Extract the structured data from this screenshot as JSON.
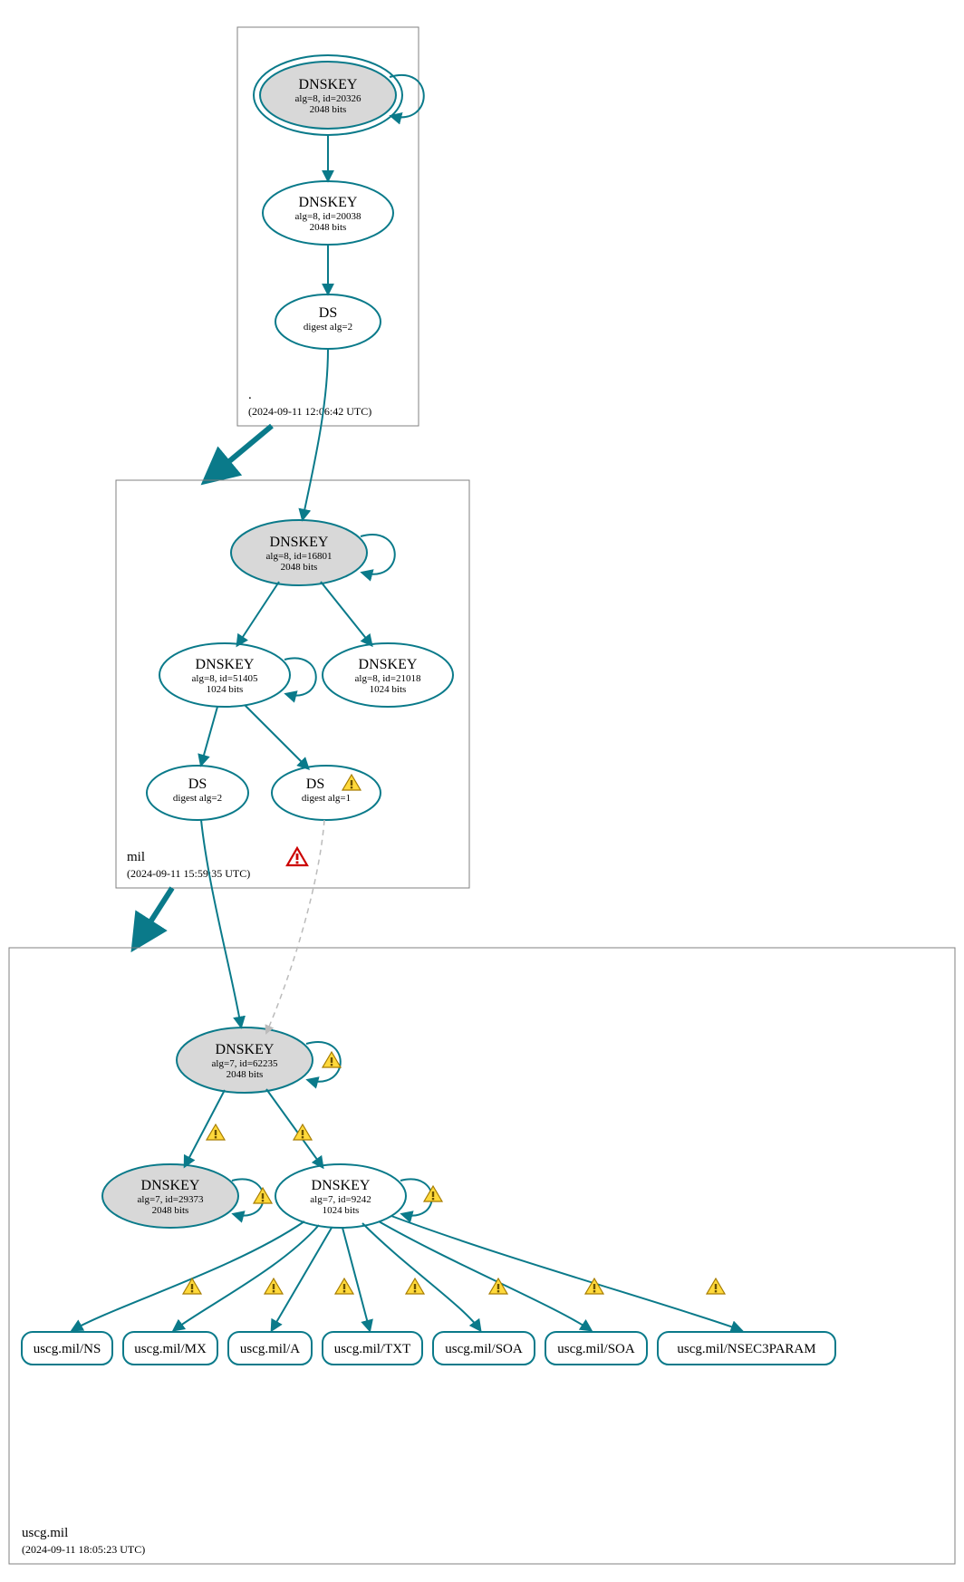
{
  "colors": {
    "accent": "#0a7a8a",
    "nodeGrey": "#d8d8d8",
    "boxStroke": "#808080",
    "dashed": "#bbbbbb",
    "warnFill": "#ffd93b",
    "warnStroke": "#a67c00",
    "errFill": "#ffffff",
    "errStroke": "#cc0000"
  },
  "zones": {
    "root": {
      "label": ".",
      "timestamp": "(2024-09-11 12:06:42 UTC)",
      "nodes": {
        "n1": {
          "title": "DNSKEY",
          "line2": "alg=8, id=20326",
          "line3": "2048 bits"
        },
        "n2": {
          "title": "DNSKEY",
          "line2": "alg=8, id=20038",
          "line3": "2048 bits"
        },
        "n3": {
          "title": "DS",
          "line2": "digest alg=2"
        }
      }
    },
    "mil": {
      "label": "mil",
      "timestamp": "(2024-09-11 15:59:35 UTC)",
      "nodes": {
        "m1": {
          "title": "DNSKEY",
          "line2": "alg=8, id=16801",
          "line3": "2048 bits"
        },
        "m2": {
          "title": "DNSKEY",
          "line2": "alg=8, id=51405",
          "line3": "1024 bits"
        },
        "m3": {
          "title": "DNSKEY",
          "line2": "alg=8, id=21018",
          "line3": "1024 bits"
        },
        "m4": {
          "title": "DS",
          "line2": "digest alg=2"
        },
        "m5": {
          "title": "DS",
          "line2": "digest alg=1"
        }
      }
    },
    "uscg": {
      "label": "uscg.mil",
      "timestamp": "(2024-09-11 18:05:23 UTC)",
      "nodes": {
        "u1": {
          "title": "DNSKEY",
          "line2": "alg=7, id=62235",
          "line3": "2048 bits"
        },
        "u2": {
          "title": "DNSKEY",
          "line2": "alg=7, id=29373",
          "line3": "2048 bits"
        },
        "u3": {
          "title": "DNSKEY",
          "line2": "alg=7, id=9242",
          "line3": "1024 bits"
        }
      },
      "rr": {
        "r1": "uscg.mil/NS",
        "r2": "uscg.mil/MX",
        "r3": "uscg.mil/A",
        "r4": "uscg.mil/TXT",
        "r5": "uscg.mil/SOA",
        "r6": "uscg.mil/SOA",
        "r7": "uscg.mil/NSEC3PARAM"
      }
    }
  }
}
